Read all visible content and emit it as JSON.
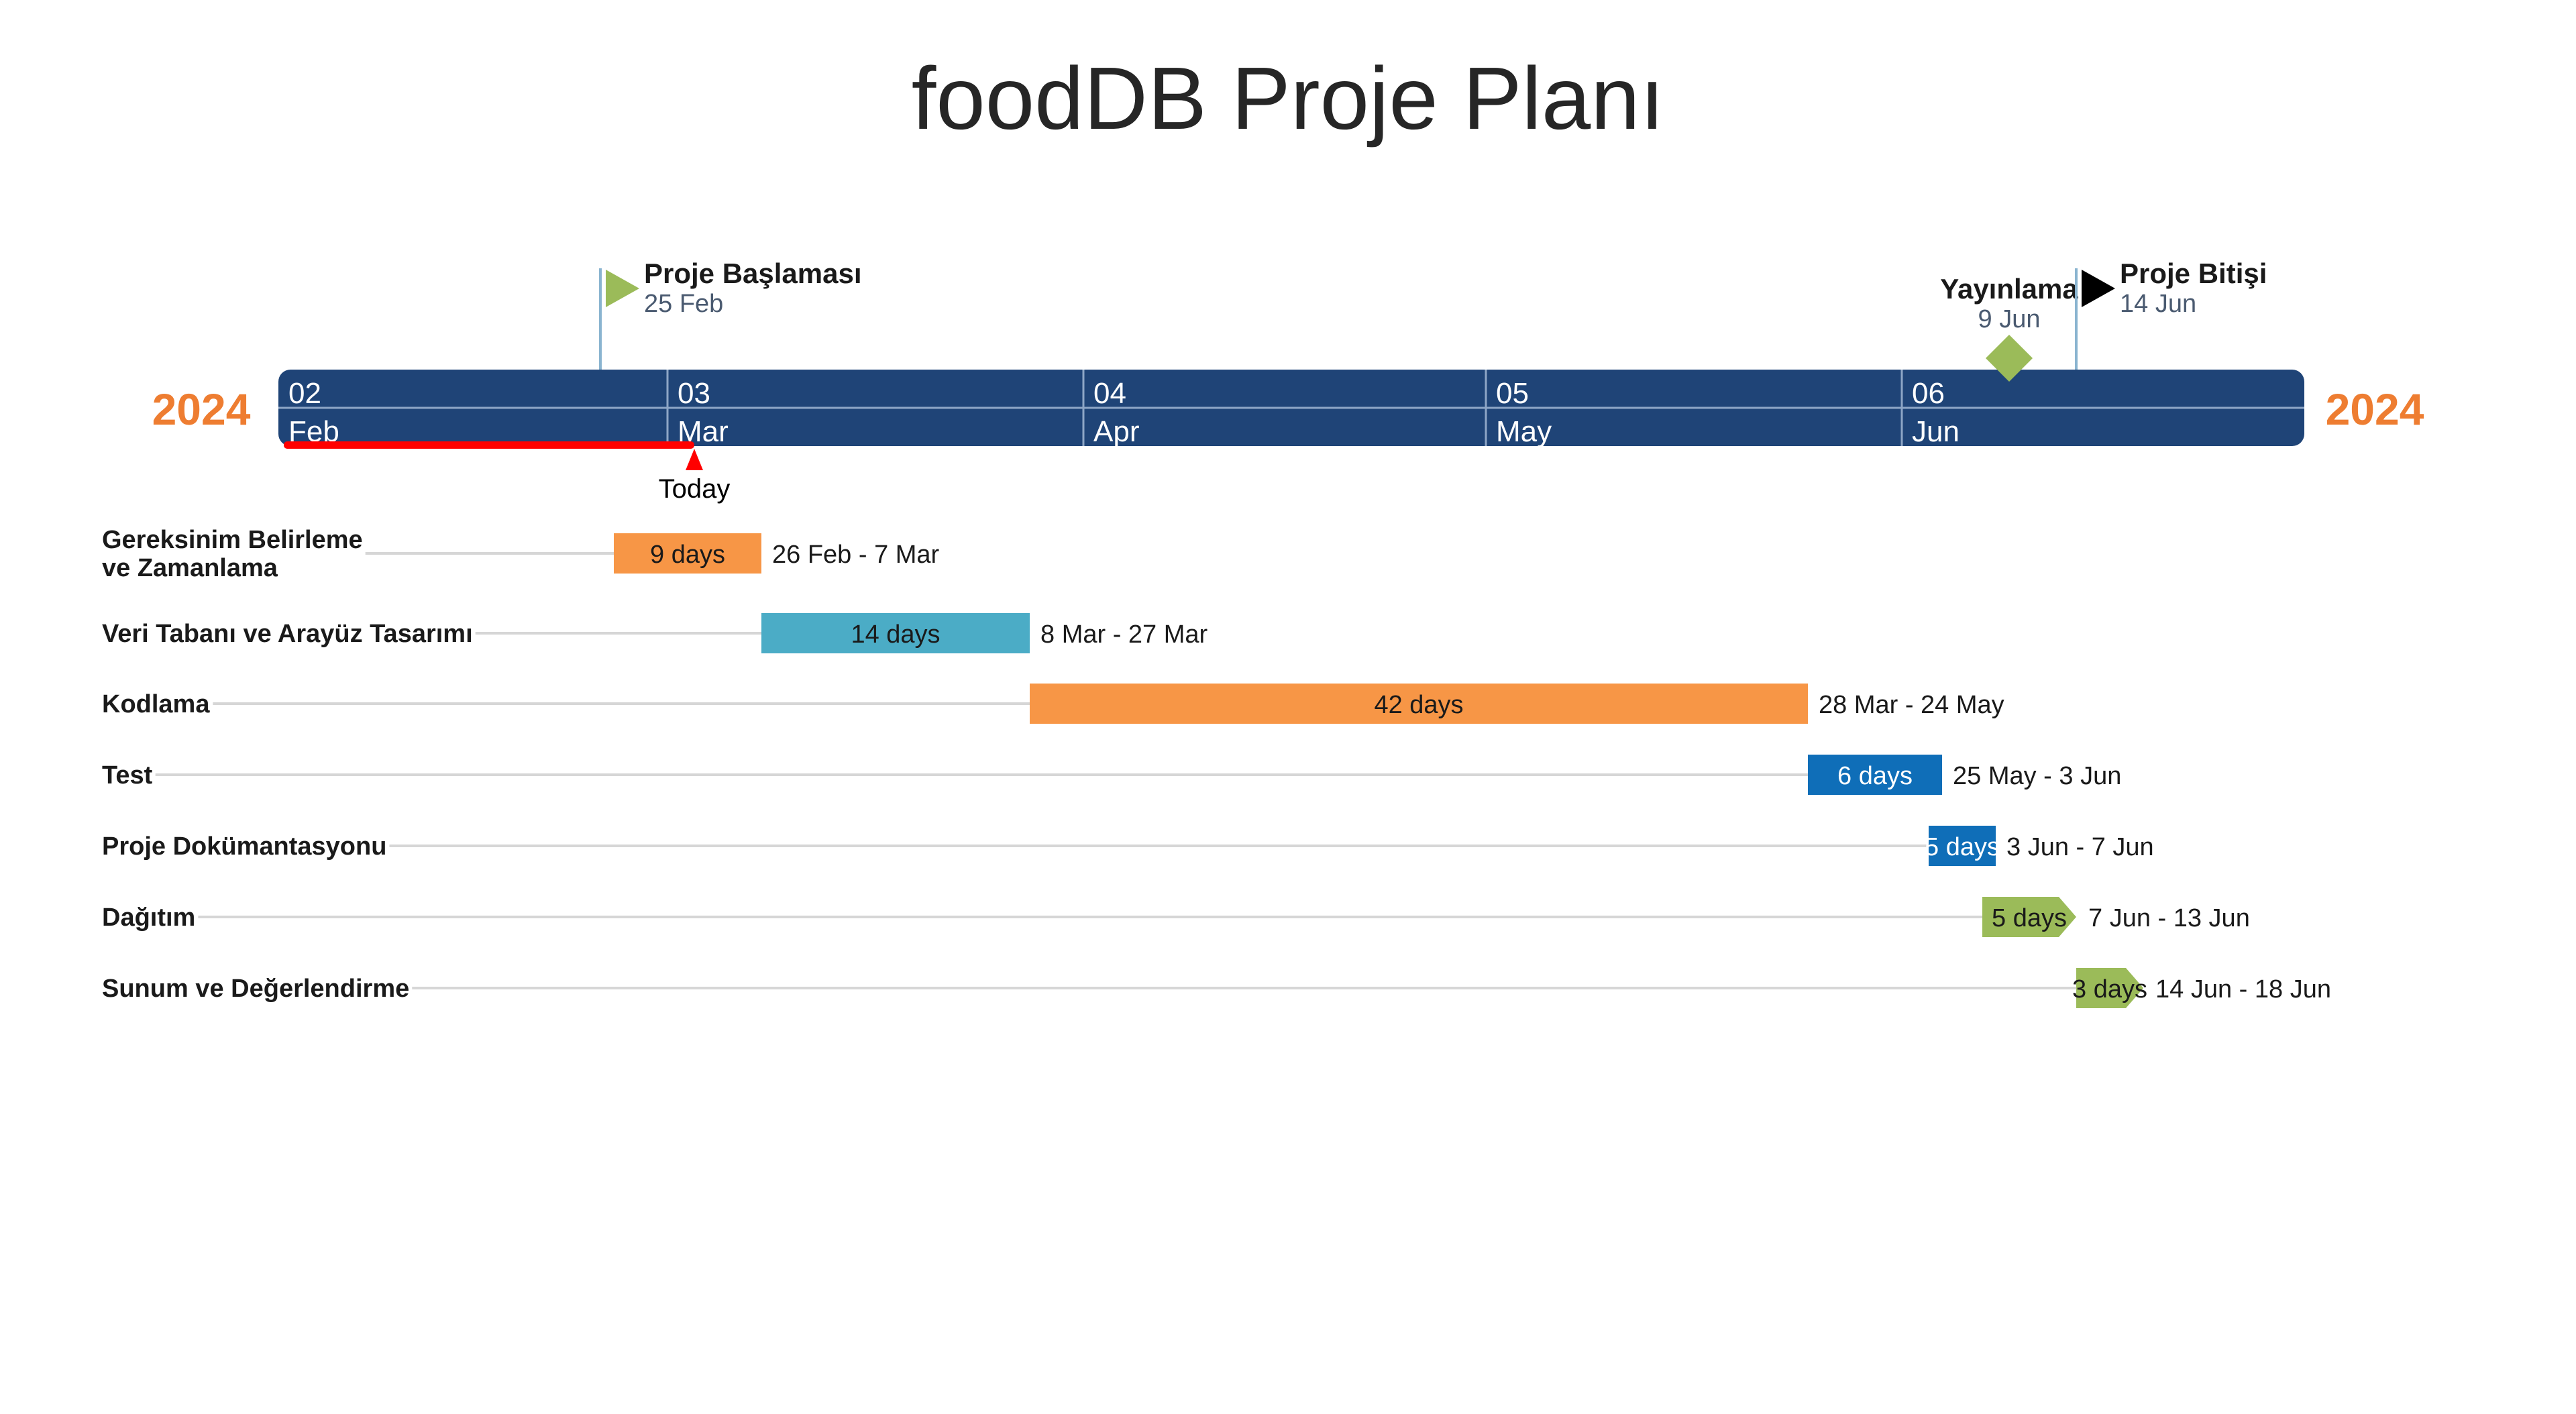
{
  "title": "foodDB Proje Planı",
  "year_left": "2024",
  "year_right": "2024",
  "colors": {
    "band": "#1f4477",
    "band_divider": "#8ea6c6",
    "year": "#ee7d31",
    "orange": "#f79646",
    "teal": "#4bacc6",
    "blue": "#0f6eb8",
    "green": "#9bbb59",
    "today": "#ff0000",
    "milestone_text": "#1a1a1a",
    "milestone_date": "#4a5a70",
    "row_line": "#d6d6d6"
  },
  "chart_data": {
    "type": "gantt",
    "axis": {
      "start": "2024-02-01",
      "end": "2024-06-30",
      "ticks": [
        {
          "date": "2024-02-01",
          "num": "02",
          "month": "Feb"
        },
        {
          "date": "2024-03-01",
          "num": "03",
          "month": "Mar"
        },
        {
          "date": "2024-04-01",
          "num": "04",
          "month": "Apr"
        },
        {
          "date": "2024-05-01",
          "num": "05",
          "month": "May"
        },
        {
          "date": "2024-06-01",
          "num": "06",
          "month": "Jun"
        }
      ]
    },
    "today": {
      "date": "2024-03-03",
      "label": "Today"
    },
    "milestones": [
      {
        "name": "Proje Başlaması",
        "date": "2024-02-25",
        "date_label": "25 Feb",
        "shape": "flag",
        "color": "#9bbb59",
        "label_side": "right"
      },
      {
        "name": "Yayınlama",
        "date": "2024-06-09",
        "date_label": "9 Jun",
        "shape": "diamond",
        "color": "#9bbb59",
        "label_side": "center"
      },
      {
        "name": "Proje Bitişi",
        "date": "2024-06-14",
        "date_label": "14 Jun",
        "shape": "flag",
        "color": "#000000",
        "label_side": "right"
      }
    ],
    "tasks": [
      {
        "name": "Gereksinim Belirleme\nve Zamanlama",
        "start": "2024-02-26",
        "end": "2024-03-07",
        "duration": "9 days",
        "range": "26 Feb - 7 Mar",
        "color": "#f79646",
        "text_color": "#1a1a1a",
        "shape": "bar"
      },
      {
        "name": "Veri Tabanı ve Arayüz Tasarımı",
        "start": "2024-03-08",
        "end": "2024-03-27",
        "duration": "14 days",
        "range": "8 Mar - 27 Mar",
        "color": "#4bacc6",
        "text_color": "#1a1a1a",
        "shape": "bar"
      },
      {
        "name": "Kodlama",
        "start": "2024-03-28",
        "end": "2024-05-24",
        "duration": "42 days",
        "range": "28 Mar - 24 May",
        "color": "#f79646",
        "text_color": "#1a1a1a",
        "shape": "bar"
      },
      {
        "name": "Test",
        "start": "2024-05-25",
        "end": "2024-06-03",
        "duration": "6 days",
        "range": "25 May - 3 Jun",
        "color": "#0f6eb8",
        "text_color": "#ffffff",
        "shape": "bar"
      },
      {
        "name": "Proje Dokümantasyonu",
        "start": "2024-06-03",
        "end": "2024-06-07",
        "duration": "5 days",
        "range": "3 Jun - 7 Jun",
        "color": "#0f6eb8",
        "text_color": "#ffffff",
        "shape": "bar"
      },
      {
        "name": "Dağıtım",
        "start": "2024-06-07",
        "end": "2024-06-13",
        "duration": "5 days",
        "range": "7 Jun - 13 Jun",
        "color": "#9bbb59",
        "text_color": "#1a1a1a",
        "shape": "arrow"
      },
      {
        "name": "Sunum ve Değerlendirme",
        "start": "2024-06-14",
        "end": "2024-06-18",
        "duration": "3 days",
        "range": "14 Jun - 18 Jun",
        "color": "#9bbb59",
        "text_color": "#1a1a1a",
        "shape": "arrow"
      }
    ]
  }
}
